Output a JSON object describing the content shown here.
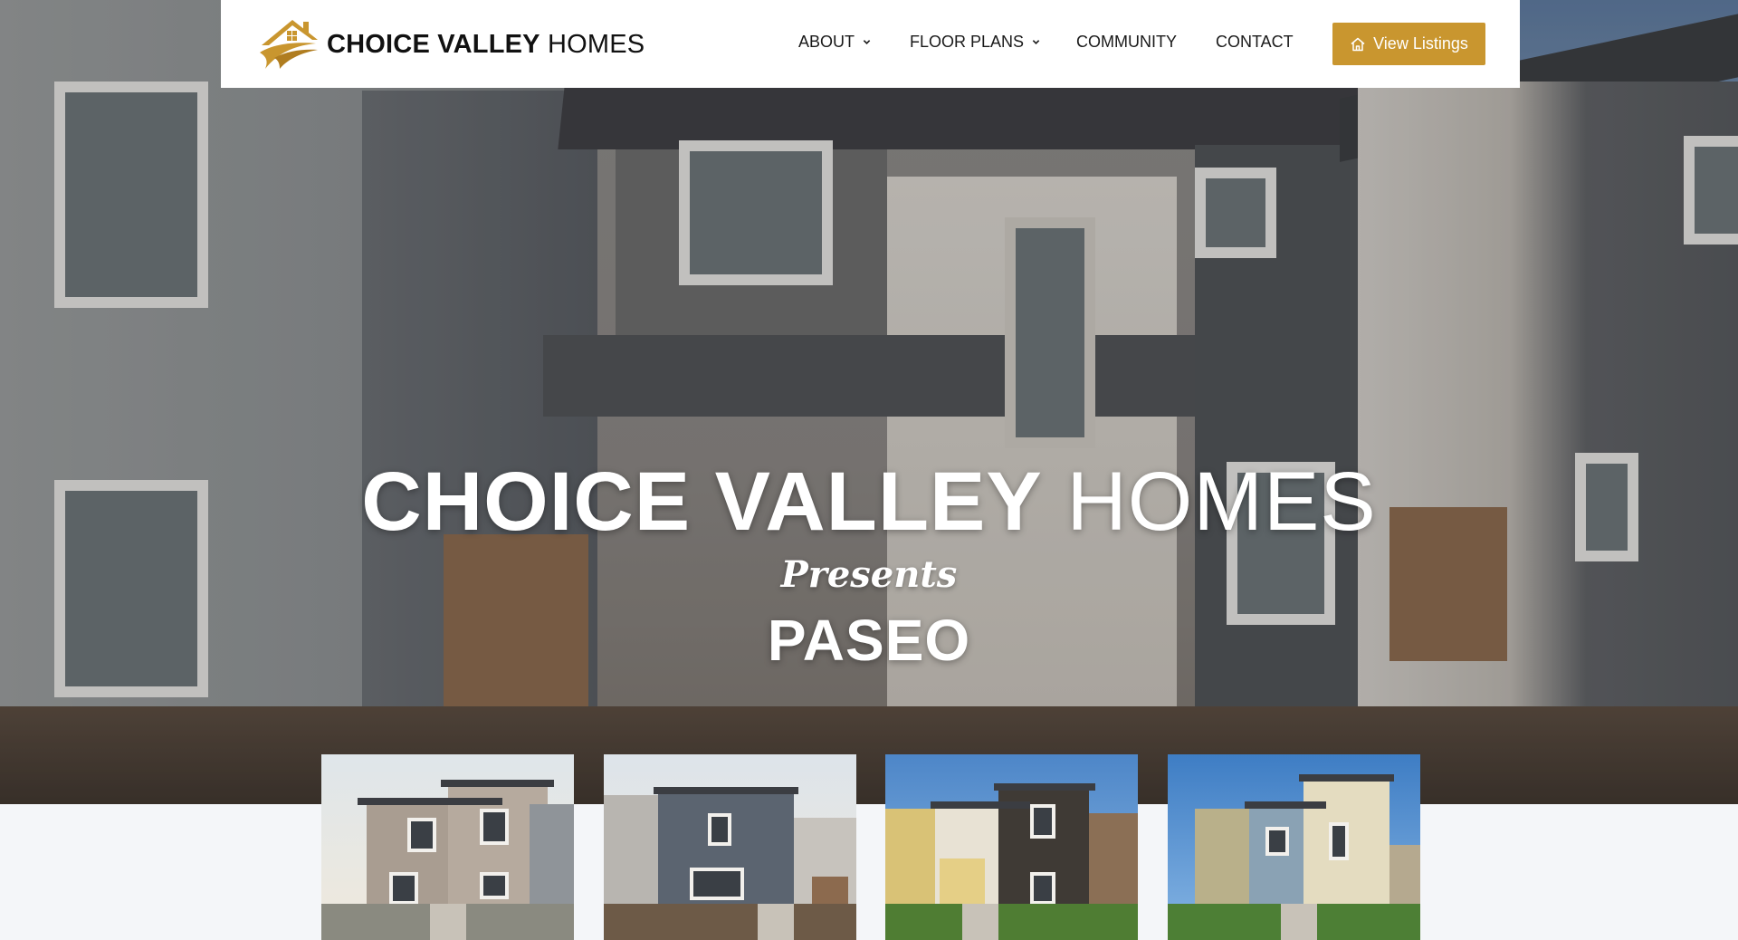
{
  "header": {
    "logo": {
      "bold": "CHOICE VALLEY",
      "light": "HOMES"
    },
    "nav": [
      {
        "label": "ABOUT",
        "has_dropdown": true
      },
      {
        "label": "FLOOR PLANS",
        "has_dropdown": true
      },
      {
        "label": "COMMUNITY",
        "has_dropdown": false
      },
      {
        "label": "CONTACT",
        "has_dropdown": false
      }
    ],
    "cta": {
      "label": "View Listings",
      "icon": "home-icon"
    }
  },
  "hero": {
    "title_bold": "CHOICE VALLEY",
    "title_light": "HOMES",
    "presents": "Presents",
    "community_name": "PASEO"
  },
  "gallery": {
    "count": 4,
    "images": [
      "home-photo",
      "home-photo",
      "home-photo",
      "home-photo"
    ]
  },
  "colors": {
    "accent": "#c9962f",
    "header_bg": "#ffffff",
    "page_bg": "#f4f6f9",
    "text": "#1a1a1a"
  }
}
